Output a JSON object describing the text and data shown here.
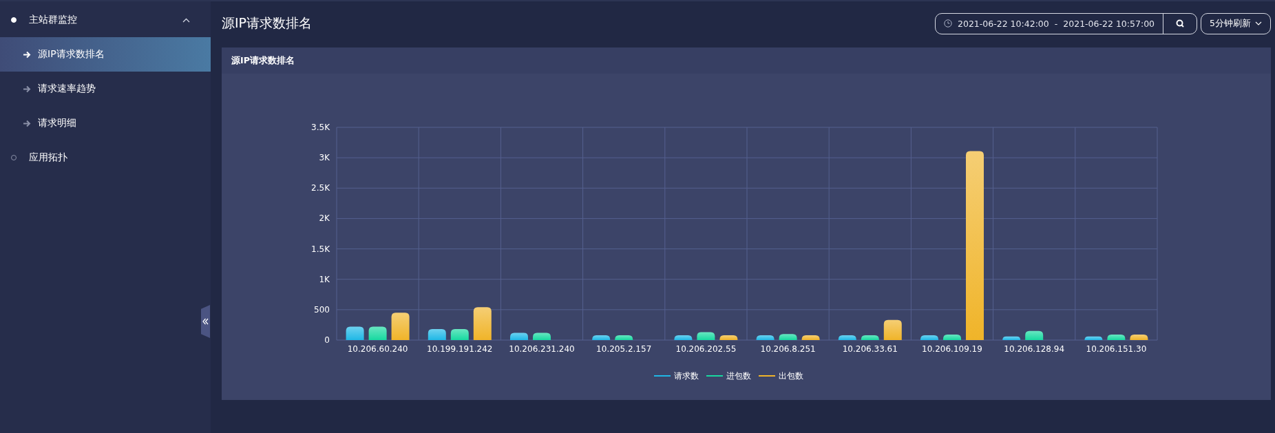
{
  "sidebar": {
    "items": [
      {
        "label": "主站群监控",
        "expanded": true,
        "children": [
          {
            "label": "源IP请求数排名",
            "selected": true
          },
          {
            "label": "请求速率趋势",
            "selected": false
          },
          {
            "label": "请求明细",
            "selected": false
          }
        ]
      },
      {
        "label": "应用拓扑",
        "expanded": false
      }
    ]
  },
  "header": {
    "title": "源IP请求数排名",
    "time_range": {
      "start": "2021-06-22 10:42:00",
      "separator": "-",
      "end": "2021-06-22 10:57:00"
    },
    "refresh": "5分钟刷新"
  },
  "panel": {
    "title": "源IP请求数排名",
    "chart_data": {
      "type": "bar",
      "categories": [
        "10.206.60.240",
        "10.199.191.242",
        "10.206.231.240",
        "10.205.2.157",
        "10.206.202.55",
        "10.206.8.251",
        "10.206.33.61",
        "10.206.109.19",
        "10.206.128.94",
        "10.206.151.30"
      ],
      "series": [
        {
          "name": "请求数",
          "color": "#1fb8e6",
          "values": [
            220,
            180,
            120,
            80,
            80,
            80,
            80,
            80,
            60,
            60
          ]
        },
        {
          "name": "进包数",
          "color": "#17d9a0",
          "values": [
            220,
            180,
            120,
            80,
            130,
            100,
            80,
            90,
            150,
            90
          ]
        },
        {
          "name": "出包数",
          "color": "#f0b429",
          "values": [
            450,
            540,
            0,
            0,
            80,
            80,
            330,
            3110,
            0,
            90
          ]
        }
      ],
      "ylim": [
        0,
        3500
      ],
      "grid": true,
      "legend": true,
      "yticks": [
        0,
        500,
        {
          "value": 1000,
          "label": "1K"
        },
        {
          "value": 1500,
          "label": "1.5K"
        },
        {
          "value": 2000,
          "label": "2K"
        },
        {
          "value": 2500,
          "label": "2.5K"
        },
        {
          "value": 3000,
          "label": "3K"
        },
        {
          "value": 3500,
          "label": "3.5K"
        }
      ]
    }
  }
}
